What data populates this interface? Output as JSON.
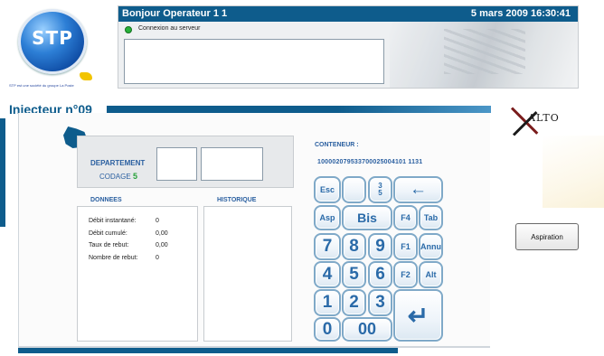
{
  "logo": {
    "text": "STP",
    "subtitle": "STP est une société du groupe La Poste"
  },
  "header": {
    "greeting": "Bonjour Operateur 1 1",
    "datetime": "5 mars 2009 16:30:41",
    "status_text": "Connexion au serveur",
    "status_color": "#27b23a"
  },
  "title": "Injecteur n°09",
  "brand": "ALTO",
  "department": {
    "label": "DEPARTEMENT",
    "codage_label": "CODAGE",
    "codage_value": "5"
  },
  "donnees": {
    "label": "DONNEES",
    "rows": [
      {
        "name": "Débit instantané:",
        "value": "0"
      },
      {
        "name": "Débit cumulé:",
        "value": "0,00"
      },
      {
        "name": "Taux de rebut:",
        "value": "0,00"
      },
      {
        "name": "Nombre de rebut:",
        "value": "0"
      }
    ]
  },
  "historique": {
    "label": "HISTORIQUE"
  },
  "conteneur": {
    "label": "CONTENEUR :",
    "value": "100002079533700025004101 1131"
  },
  "keypad": {
    "esc": "Esc",
    "frac_top": "3",
    "frac_bottom": "5",
    "backspace": "←",
    "asp": "Asp",
    "bis": "Bis",
    "f4": "F4",
    "tab": "Tab",
    "k7": "7",
    "k8": "8",
    "k9": "9",
    "f1": "F1",
    "annu": "Annu",
    "k4": "4",
    "k5": "5",
    "k6": "6",
    "f2": "F2",
    "alt": "Alt",
    "k1": "1",
    "k2": "2",
    "k3": "3",
    "enter": "↵",
    "k0": "0",
    "k00": "00"
  },
  "aspiration_label": "Aspiration",
  "colors": {
    "primary": "#0e5c8c",
    "accent_blue": "#2a5fa0",
    "key_text": "#2a6aa8"
  }
}
